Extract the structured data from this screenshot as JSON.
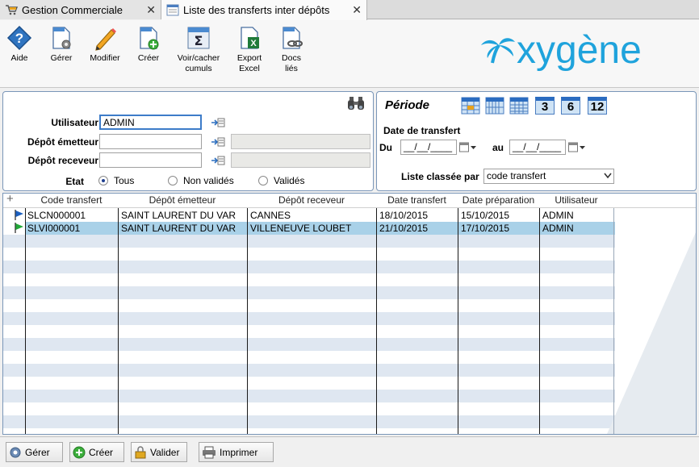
{
  "tabs": [
    {
      "label": "Gestion Commerciale",
      "close": "✕"
    },
    {
      "label": "Liste des transferts inter dépôts",
      "close": "✕"
    }
  ],
  "toolbar": {
    "help": {
      "label": "Aide",
      "icon": "help-icon"
    },
    "manage": {
      "label": "Gérer",
      "icon": "manage-doc-icon"
    },
    "edit": {
      "label": "Modifier",
      "icon": "pencil-icon"
    },
    "create": {
      "label": "Créer",
      "icon": "new-doc-icon"
    },
    "cumuls": {
      "label1": "Voir/cacher",
      "label2": "cumuls",
      "icon": "sigma-icon"
    },
    "export": {
      "label1": "Export",
      "label2": "Excel",
      "icon": "excel-icon"
    },
    "docs": {
      "label1": "Docs",
      "label2": "liés",
      "icon": "link-doc-icon"
    }
  },
  "logo": {
    "text": "oxygène",
    "color": "#1fa3dc"
  },
  "filter": {
    "user_label": "Utilisateur",
    "user_value": "ADMIN",
    "sender_label": "Dépôt émetteur",
    "sender_value": "",
    "receiver_label": "Dépôt receveur",
    "receiver_value": "",
    "state_label": "Etat",
    "states": [
      "Tous",
      "Non validés",
      "Validés"
    ],
    "state_selected": "Tous"
  },
  "period": {
    "title": "Période",
    "date_label": "Date de transfert",
    "from_label": "Du",
    "from_value": "__/__/____",
    "to_label": "au",
    "to_value": "__/__/____",
    "quick_buttons": [
      "3",
      "6",
      "12"
    ],
    "sort_label": "Liste classée par",
    "sort_value": "code transfert"
  },
  "grid": {
    "add_icon": "+",
    "columns": [
      "Code transfert",
      "Dépôt émetteur",
      "Dépôt receveur",
      "Date transfert",
      "Date préparation",
      "Utilisateur"
    ],
    "rows": [
      {
        "code": "SLCN000001",
        "sender": "SAINT LAURENT DU VAR",
        "receiver": "CANNES",
        "transfer_date": "18/10/2015",
        "prep_date": "15/10/2015",
        "user": "ADMIN",
        "flag_color": "#1c5fbf"
      },
      {
        "code": "SLVI000001",
        "sender": "SAINT LAURENT DU VAR",
        "receiver": "VILLENEUVE LOUBET",
        "transfer_date": "21/10/2015",
        "prep_date": "17/10/2015",
        "user": "ADMIN",
        "flag_color": "#22a838"
      }
    ],
    "selected_row_color": "#a9d1e8"
  },
  "bottom": {
    "manage": "Gérer",
    "create": "Créer",
    "validate": "Valider",
    "print": "Imprimer"
  }
}
